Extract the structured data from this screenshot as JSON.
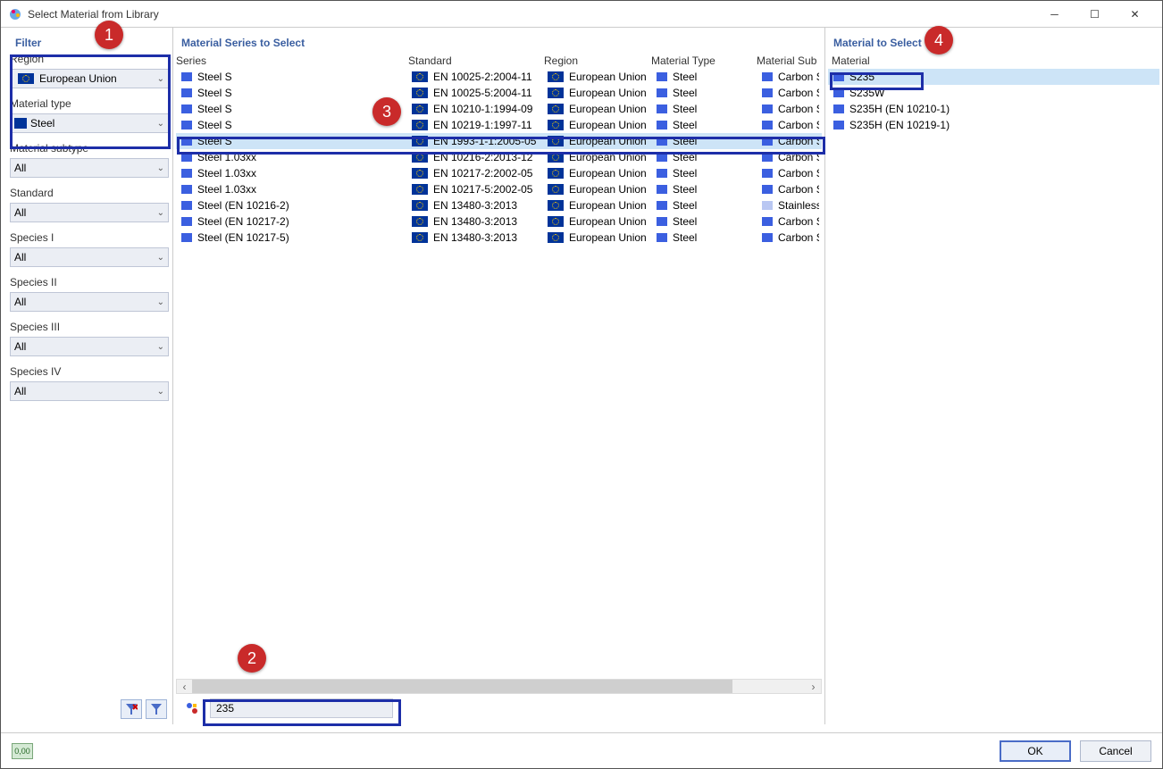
{
  "window": {
    "title": "Select Material from Library"
  },
  "callouts": [
    "1",
    "2",
    "3",
    "4"
  ],
  "filter": {
    "header": "Filter",
    "groups": [
      {
        "label": "Region",
        "value": "European Union",
        "icon": "euflag"
      },
      {
        "label": "Material type",
        "value": "Steel",
        "icon": "swatch"
      },
      {
        "label": "Material subtype",
        "value": "All",
        "icon": "none"
      },
      {
        "label": "Standard",
        "value": "All",
        "icon": "none"
      },
      {
        "label": "Species I",
        "value": "All",
        "icon": "none"
      },
      {
        "label": "Species II",
        "value": "All",
        "icon": "none"
      },
      {
        "label": "Species III",
        "value": "All",
        "icon": "none"
      },
      {
        "label": "Species IV",
        "value": "All",
        "icon": "none"
      }
    ]
  },
  "series": {
    "header": "Material Series to Select",
    "columns": [
      "Series",
      "Standard",
      "Region",
      "Material Type",
      "Material Subtype"
    ],
    "rows": [
      {
        "series": "Steel S",
        "standard": "EN 10025-2:2004-11",
        "region": "European Union",
        "mt": "Steel",
        "sub": "Carbon St",
        "sw": "blue"
      },
      {
        "series": "Steel S",
        "standard": "EN 10025-5:2004-11",
        "region": "European Union",
        "mt": "Steel",
        "sub": "Carbon St",
        "sw": "blue"
      },
      {
        "series": "Steel S",
        "standard": "EN 10210-1:1994-09",
        "region": "European Union",
        "mt": "Steel",
        "sub": "Carbon St",
        "sw": "blue"
      },
      {
        "series": "Steel S",
        "standard": "EN 10219-1:1997-11",
        "region": "European Union",
        "mt": "Steel",
        "sub": "Carbon St",
        "sw": "blue"
      },
      {
        "series": "Steel S",
        "standard": "EN 1993-1-1:2005-05",
        "region": "European Union",
        "mt": "Steel",
        "sub": "Carbon St",
        "sw": "blue",
        "selected": true
      },
      {
        "series": "Steel 1.03xx",
        "standard": "EN 10216-2:2013-12",
        "region": "European Union",
        "mt": "Steel",
        "sub": "Carbon St",
        "sw": "blue"
      },
      {
        "series": "Steel 1.03xx",
        "standard": "EN 10217-2:2002-05",
        "region": "European Union",
        "mt": "Steel",
        "sub": "Carbon St",
        "sw": "blue"
      },
      {
        "series": "Steel 1.03xx",
        "standard": "EN 10217-5:2002-05",
        "region": "European Union",
        "mt": "Steel",
        "sub": "Carbon St",
        "sw": "blue"
      },
      {
        "series": "Steel (EN 10216-2)",
        "standard": "EN 13480-3:2013",
        "region": "European Union",
        "mt": "Steel",
        "sub": "Stainless S",
        "sw": "lblue"
      },
      {
        "series": "Steel (EN 10217-2)",
        "standard": "EN 13480-3:2013",
        "region": "European Union",
        "mt": "Steel",
        "sub": "Carbon St",
        "sw": "blue"
      },
      {
        "series": "Steel (EN 10217-5)",
        "standard": "EN 13480-3:2013",
        "region": "European Union",
        "mt": "Steel",
        "sub": "Carbon St",
        "sw": "blue"
      }
    ],
    "search_value": "235"
  },
  "material": {
    "header": "Material to Select",
    "column": "Material",
    "rows": [
      {
        "name": "S235",
        "selected": true
      },
      {
        "name": "S235W"
      },
      {
        "name": "S235H (EN 10210-1)"
      },
      {
        "name": "S235H (EN 10219-1)"
      }
    ]
  },
  "footer": {
    "ok": "OK",
    "cancel": "Cancel",
    "unit": "0,00"
  }
}
